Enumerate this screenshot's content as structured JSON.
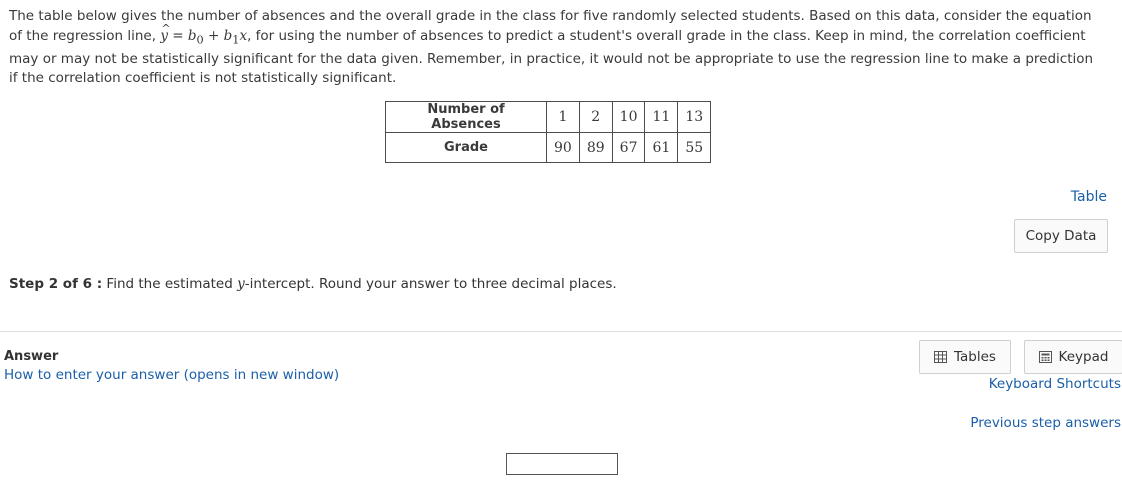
{
  "intro": {
    "part1": "The table below gives the number of absences and the overall grade in the class for five randomly selected students. Based on this data, consider the equation of the regression line,",
    "eq_y": "y",
    "eq_equals": "=",
    "eq_b0": "b",
    "eq_sub0": "0",
    "eq_plus": "+",
    "eq_b1": "b",
    "eq_sub1": "1",
    "eq_x": "x",
    "part2": ", for using the number of absences to predict a student's overall grade in the class. Keep in mind, the correlation coefficient may or may not be statistically significant for the data given. Remember, in practice, it would not be appropriate to use the regression line to make a prediction if the correlation coefficient is not statistically significant."
  },
  "table": {
    "rows": [
      {
        "header": "Number of Absences",
        "values": [
          "1",
          "2",
          "10",
          "11",
          "13"
        ]
      },
      {
        "header": "Grade",
        "values": [
          "90",
          "89",
          "67",
          "61",
          "55"
        ]
      }
    ]
  },
  "side": {
    "table_link": "Table",
    "copy_data": "Copy Data"
  },
  "step": {
    "label": "Step 2 of 6 :",
    "text_before": " Find the estimated ",
    "var": "y",
    "text_after": "-intercept. Round your answer to three decimal places."
  },
  "answer": {
    "label": "Answer",
    "howto": "How to enter your answer (opens in new window)",
    "tables_btn": "Tables",
    "keypad_btn": "Keypad",
    "shortcuts": "Keyboard Shortcuts",
    "previous": "Previous step answers",
    "input_value": ""
  },
  "icons": {
    "tables": "table-grid-icon",
    "keypad": "keypad-icon"
  },
  "colors": {
    "link": "#1b5fa8",
    "text": "#333333",
    "divider": "#dedede"
  }
}
